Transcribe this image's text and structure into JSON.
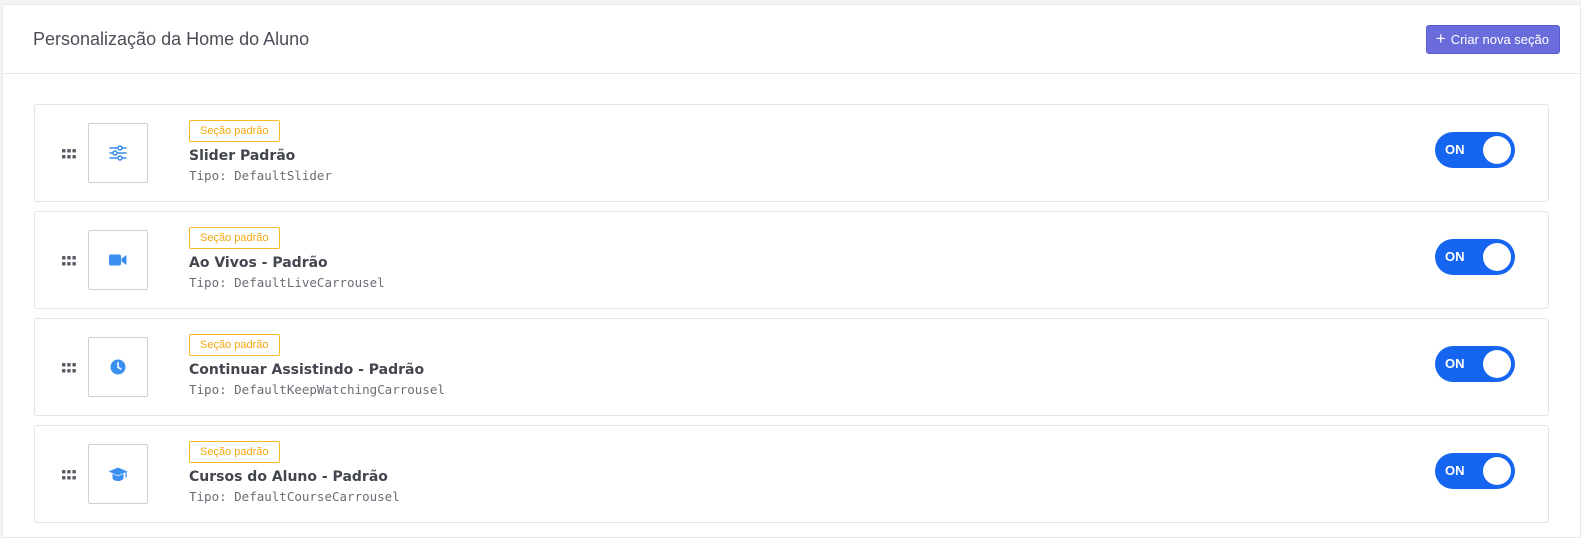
{
  "header": {
    "title": "Personalização da Home do Aluno",
    "create_button_label": "Criar nova seção",
    "create_button_icon": "plus-icon"
  },
  "colors": {
    "accent": "#6a6cdc",
    "toggle_on": "#1565f0",
    "badge": "#f7b924",
    "icon": "#3a8ff0"
  },
  "sections": [
    {
      "badge": "Seção padrão",
      "name": "Slider Padrão",
      "type": "Tipo: DefaultSlider",
      "icon": "sliders-icon",
      "toggle": "ON"
    },
    {
      "badge": "Seção padrão",
      "name": "Ao Vivos - Padrão",
      "type": "Tipo: DefaultLiveCarrousel",
      "icon": "video-camera-icon",
      "toggle": "ON"
    },
    {
      "badge": "Seção padrão",
      "name": "Continuar Assistindo - Padrão",
      "type": "Tipo: DefaultKeepWatchingCarrousel",
      "icon": "clock-icon",
      "toggle": "ON"
    },
    {
      "badge": "Seção padrão",
      "name": "Cursos do Aluno - Padrão",
      "type": "Tipo: DefaultCourseCarrousel",
      "icon": "graduation-cap-icon",
      "toggle": "ON"
    }
  ]
}
